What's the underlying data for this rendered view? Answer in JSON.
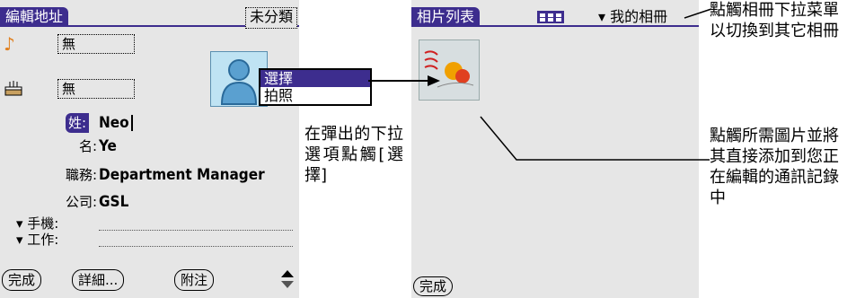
{
  "left_screen": {
    "title": "編輯地址",
    "category": "未分類",
    "ringtone_value": "無",
    "alarm_value": "無",
    "popup": {
      "items": [
        "選擇",
        "拍照"
      ],
      "selected_index": 0
    },
    "fields": [
      {
        "label": "姓:",
        "value": "Neo"
      },
      {
        "label": "名:",
        "value": "Ye"
      },
      {
        "label": "職務:",
        "value": "Department Manager"
      },
      {
        "label": "公司:",
        "value": "GSL"
      },
      {
        "label": "▾ 手機:",
        "value": ""
      },
      {
        "label": "▾ 工作:",
        "value": ""
      }
    ],
    "buttons": {
      "done": "完成",
      "details": "詳細...",
      "note": "附注"
    }
  },
  "right_screen": {
    "title": "相片列表",
    "album_trigger": "▾ 我的相冊",
    "buttons": {
      "done": "完成"
    }
  },
  "captions": {
    "popup_instruction": "在彈出的下拉選項點觸[選擇]",
    "album_instruction": "點觸相冊下拉菜單以切換到其它相冊",
    "select_instruction": "點觸所需圖片並將其直接添加到您正在編輯的通訊記錄中"
  },
  "colors": {
    "accent": "#3d2d8e",
    "screen_bg": "#e6e6e6"
  }
}
